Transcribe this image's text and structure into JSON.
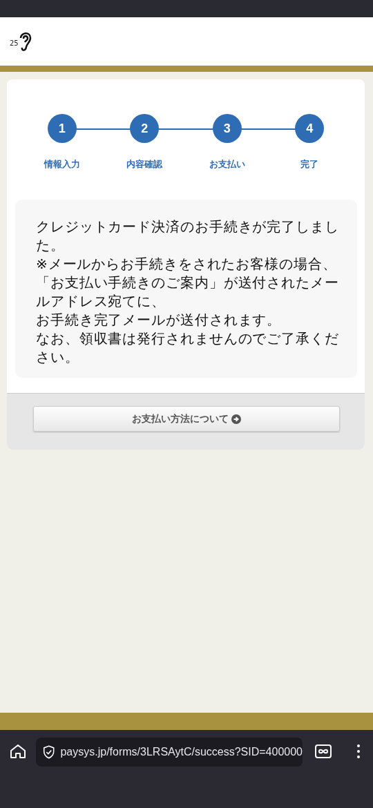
{
  "header": {
    "logo_text": "25"
  },
  "steps": [
    {
      "number": "1",
      "label": "情報入力"
    },
    {
      "number": "2",
      "label": "内容確認"
    },
    {
      "number": "3",
      "label": "お支払い"
    },
    {
      "number": "4",
      "label": "完了"
    }
  ],
  "message": [
    "クレジットカード決済のお手続きが完了しました。",
    "※メールからお手続きをされたお客様の場合、",
    "「お支払い手続きのご案内」が送付されたメールアドレス宛てに、",
    "お手続き完了メールが送付されます。",
    "なお、領収書は発行されませんのでご了承ください。"
  ],
  "button": {
    "label": "お支払い方法について"
  },
  "browser": {
    "url": "paysys.jp/forms/3LRSAytC/success?SID=400000"
  }
}
